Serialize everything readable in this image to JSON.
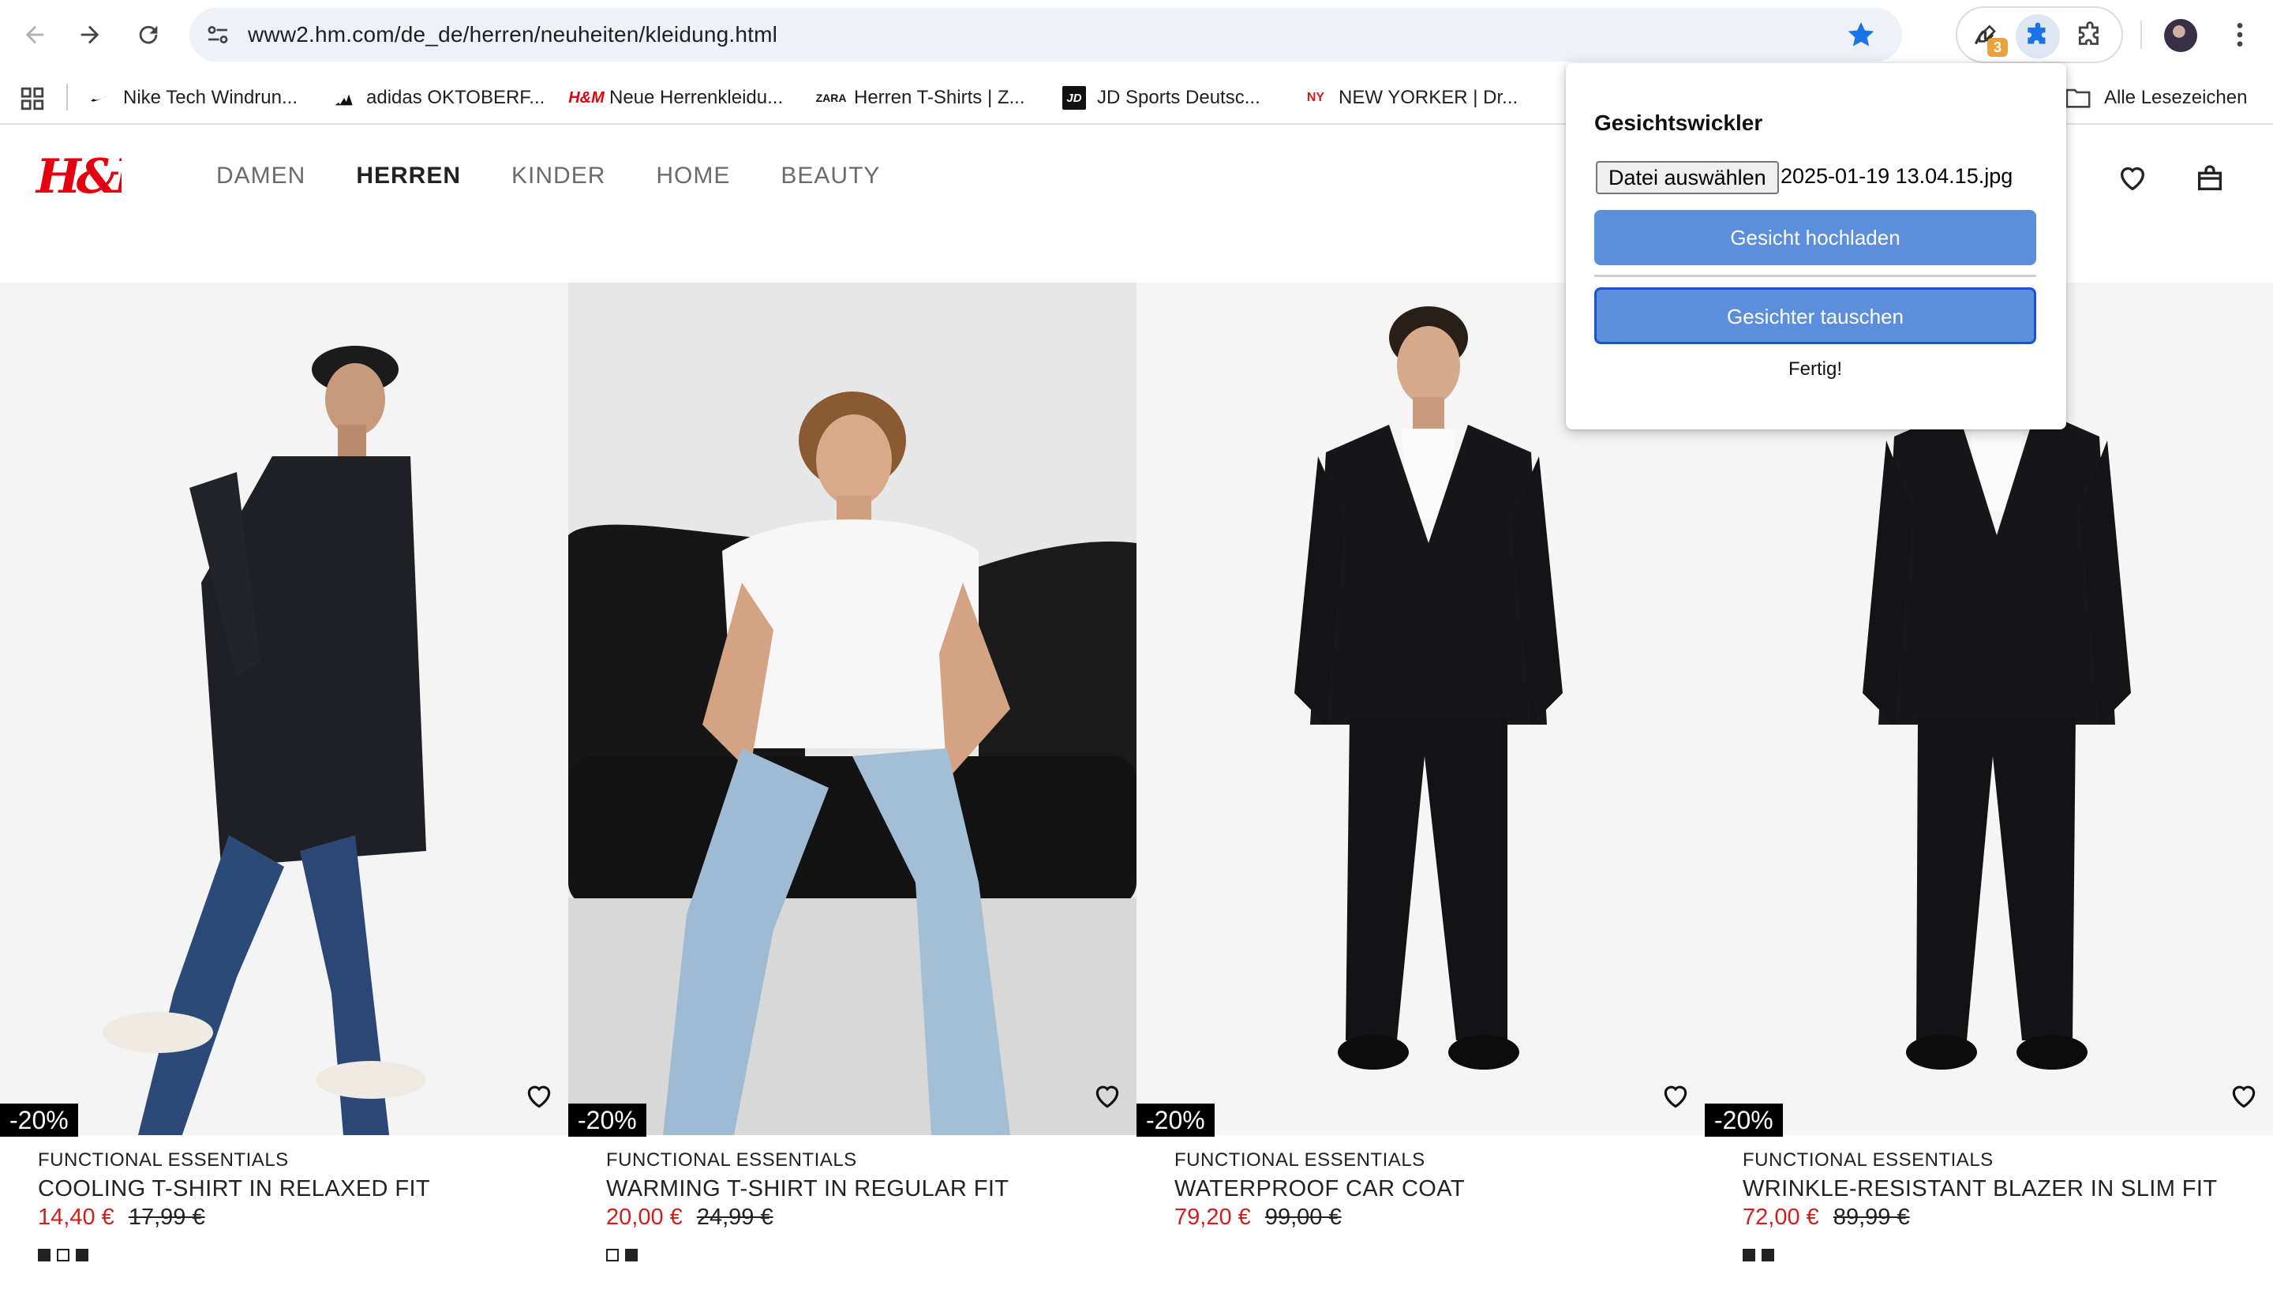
{
  "browser": {
    "url": "www2.hm.com/de_de/herren/neuheiten/kleidung.html",
    "extension_badge": "3",
    "bookmarks": [
      {
        "label": "Nike Tech Windrun...",
        "icon": "nike-swoosh-icon"
      },
      {
        "label": "adidas OKTOBERF...",
        "icon": "adidas-icon"
      },
      {
        "label": "Neue Herrenkleidu...",
        "icon": "hm-icon"
      },
      {
        "label": "Herren T-Shirts | Z...",
        "icon": "zara-icon"
      },
      {
        "label": "JD Sports Deutsc...",
        "icon": "jd-icon"
      },
      {
        "label": "NEW YORKER | Dr...",
        "icon": "newyorker-icon"
      }
    ],
    "all_bookmarks_label": "Alle Lesezeichen"
  },
  "site": {
    "logo": "H&M",
    "nav": [
      "DAMEN",
      "HERREN",
      "KINDER",
      "HOME",
      "BEAUTY"
    ],
    "active_nav": "HERREN"
  },
  "products": [
    {
      "discount": "-20%",
      "brand": "FUNCTIONAL ESSENTIALS",
      "name": "COOLING T-SHIRT IN RELAXED FIT",
      "price": "14,40 €",
      "old_price": "17,99 €",
      "swatches": [
        "dark",
        "light",
        "dark"
      ]
    },
    {
      "discount": "-20%",
      "brand": "FUNCTIONAL ESSENTIALS",
      "name": "WARMING T-SHIRT IN REGULAR FIT",
      "price": "20,00 €",
      "old_price": "24,99 €",
      "swatches": [
        "light",
        "dark"
      ]
    },
    {
      "discount": "-20%",
      "brand": "FUNCTIONAL ESSENTIALS",
      "name": "WATERPROOF CAR COAT",
      "price": "79,20 €",
      "old_price": "99,00 €",
      "swatches": []
    },
    {
      "discount": "-20%",
      "brand": "FUNCTIONAL ESSENTIALS",
      "name": "WRINKLE-RESISTANT BLAZER IN SLIM FIT",
      "price": "72,00 €",
      "old_price": "89,99 €",
      "swatches": [
        "dark",
        "dark"
      ]
    }
  ],
  "popup": {
    "title": "Gesichtswickler",
    "file_button": "Datei auswählen",
    "file_name": "2025-01-19 13.04.15.jpg",
    "upload_button": "Gesicht hochladen",
    "swap_button": "Gesichter tauschen",
    "status": "Fertig!"
  },
  "colors": {
    "sale_red": "#d11e1e",
    "popup_button": "#5b8fdb",
    "chrome_star": "#1a73e8"
  }
}
